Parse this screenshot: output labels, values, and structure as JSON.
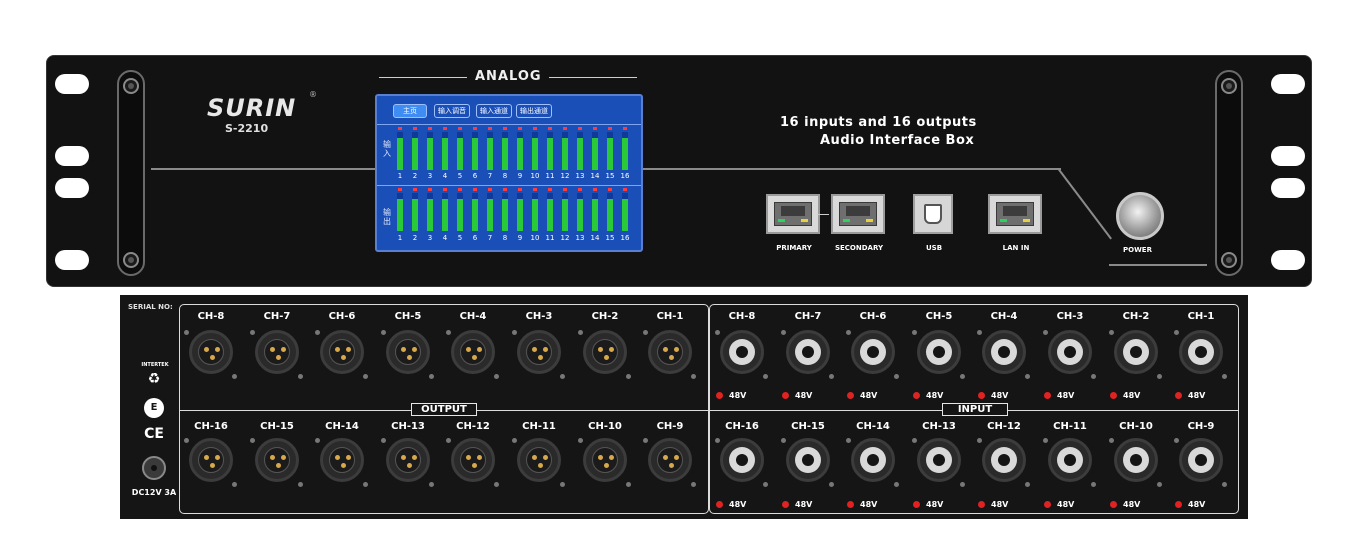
{
  "front": {
    "brand": "SURIN",
    "registered_mark": "®",
    "model": "S-2210",
    "section_label": "ANALOG",
    "description_line1": "16 inputs and 16 outputs",
    "description_line2": "Audio Interface Box",
    "screen": {
      "tabs": [
        "主页",
        "输入调音",
        "输入通道",
        "输出通道"
      ],
      "active_tab": 0,
      "input_label": "输入",
      "output_label": "输出",
      "channels": [
        "1",
        "2",
        "3",
        "4",
        "5",
        "6",
        "7",
        "8",
        "9",
        "10",
        "11",
        "12",
        "13",
        "14",
        "15",
        "16"
      ],
      "input_levels": [
        0.85,
        0.85,
        0.85,
        0.85,
        0.85,
        0.85,
        0.85,
        0.85,
        0.85,
        0.85,
        0.85,
        0.85,
        0.85,
        0.85,
        0.85,
        0.85
      ],
      "output_levels": [
        0.85,
        0.85,
        0.85,
        0.85,
        0.85,
        0.85,
        0.85,
        0.85,
        0.85,
        0.85,
        0.85,
        0.85,
        0.85,
        0.85,
        0.85,
        0.85
      ],
      "bg_color": "#1a4fb8",
      "meter_color": "#29c93a",
      "peak_color": "#ff3b3b"
    },
    "ports": {
      "primary": "PRIMARY",
      "secondary": "SECONDARY",
      "usb": "USB",
      "lan_in": "LAN IN",
      "power": "POWER"
    }
  },
  "rear": {
    "serial_label": "SERIAL NO:",
    "output_label": "OUTPUT",
    "input_label": "INPUT",
    "output_top": [
      "CH-8",
      "CH-7",
      "CH-6",
      "CH-5",
      "CH-4",
      "CH-3",
      "CH-2",
      "CH-1"
    ],
    "output_bottom": [
      "CH-16",
      "CH-15",
      "CH-14",
      "CH-13",
      "CH-12",
      "CH-11",
      "CH-10",
      "CH-9"
    ],
    "input_top": [
      "CH-8",
      "CH-7",
      "CH-6",
      "CH-5",
      "CH-4",
      "CH-3",
      "CH-2",
      "CH-1"
    ],
    "input_bottom": [
      "CH-16",
      "CH-15",
      "CH-14",
      "CH-13",
      "CH-12",
      "CH-11",
      "CH-10",
      "CH-9"
    ],
    "phantom_label": "48V",
    "certifications": {
      "intertek": "INTERTEK",
      "ce": "CE"
    },
    "power_input": "DC12V 3A",
    "phantom_led_color": "#e02222",
    "pin_color": "#d8a94a"
  }
}
